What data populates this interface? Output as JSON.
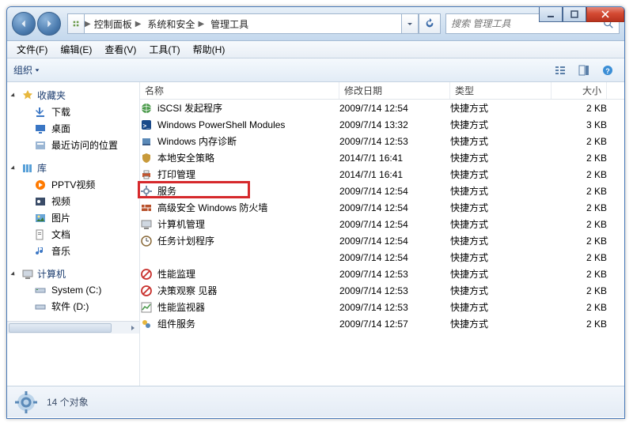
{
  "titlebar": {
    "breadcrumb": [
      "控制面板",
      "系统和安全",
      "管理工具"
    ],
    "search_placeholder": "搜索 管理工具"
  },
  "menubar": {
    "file": "文件(F)",
    "edit": "编辑(E)",
    "view": "查看(V)",
    "tools": "工具(T)",
    "help": "帮助(H)"
  },
  "toolbar": {
    "organize": "组织"
  },
  "sidebar": {
    "favorites": {
      "label": "收藏夹",
      "items": [
        "下载",
        "桌面",
        "最近访问的位置"
      ]
    },
    "libraries": {
      "label": "库",
      "items": [
        "PPTV视频",
        "视频",
        "图片",
        "文档",
        "音乐"
      ]
    },
    "computer": {
      "label": "计算机",
      "items": [
        "System (C:)",
        "软件 (D:)"
      ]
    }
  },
  "columns": {
    "name": "名称",
    "date": "修改日期",
    "type": "类型",
    "size": "大小"
  },
  "rows": [
    {
      "icon": "globe",
      "name": "iSCSI 发起程序",
      "date": "2009/7/14 12:54",
      "type": "快捷方式",
      "size": "2 KB"
    },
    {
      "icon": "ps",
      "name": "Windows PowerShell Modules",
      "date": "2009/7/14 13:32",
      "type": "快捷方式",
      "size": "3 KB"
    },
    {
      "icon": "mem",
      "name": "Windows 内存诊断",
      "date": "2009/7/14 12:53",
      "type": "快捷方式",
      "size": "2 KB"
    },
    {
      "icon": "shield",
      "name": "本地安全策略",
      "date": "2014/7/1 16:41",
      "type": "快捷方式",
      "size": "2 KB"
    },
    {
      "icon": "printer",
      "name": "打印管理",
      "date": "2014/7/1 16:41",
      "type": "快捷方式",
      "size": "2 KB"
    },
    {
      "icon": "gear",
      "name": "服务",
      "date": "2009/7/14 12:54",
      "type": "快捷方式",
      "size": "2 KB",
      "highlighted": true
    },
    {
      "icon": "fw",
      "name": "高级安全 Windows 防火墙",
      "date": "2009/7/14 12:54",
      "type": "快捷方式",
      "size": "2 KB"
    },
    {
      "icon": "pc",
      "name": "计算机管理",
      "date": "2009/7/14 12:54",
      "type": "快捷方式",
      "size": "2 KB"
    },
    {
      "icon": "clock",
      "name": "任务计划程序",
      "date": "2009/7/14 12:54",
      "type": "快捷方式",
      "size": "2 KB"
    },
    {
      "icon": "blank",
      "name": "",
      "date": "2009/7/14 12:54",
      "type": "快捷方式",
      "size": "2 KB"
    },
    {
      "icon": "deny",
      "name": "性能监理",
      "date": "2009/7/14 12:53",
      "type": "快捷方式",
      "size": "2 KB"
    },
    {
      "icon": "deny",
      "name": "决策观察    见器",
      "date": "2009/7/14 12:53",
      "type": "快捷方式",
      "size": "2 KB"
    },
    {
      "icon": "perf",
      "name": "性能监视器",
      "date": "2009/7/14 12:53",
      "type": "快捷方式",
      "size": "2 KB"
    },
    {
      "icon": "comp",
      "name": "组件服务",
      "date": "2009/7/14 12:57",
      "type": "快捷方式",
      "size": "2 KB"
    }
  ],
  "statusbar": {
    "text": "14 个对象"
  }
}
